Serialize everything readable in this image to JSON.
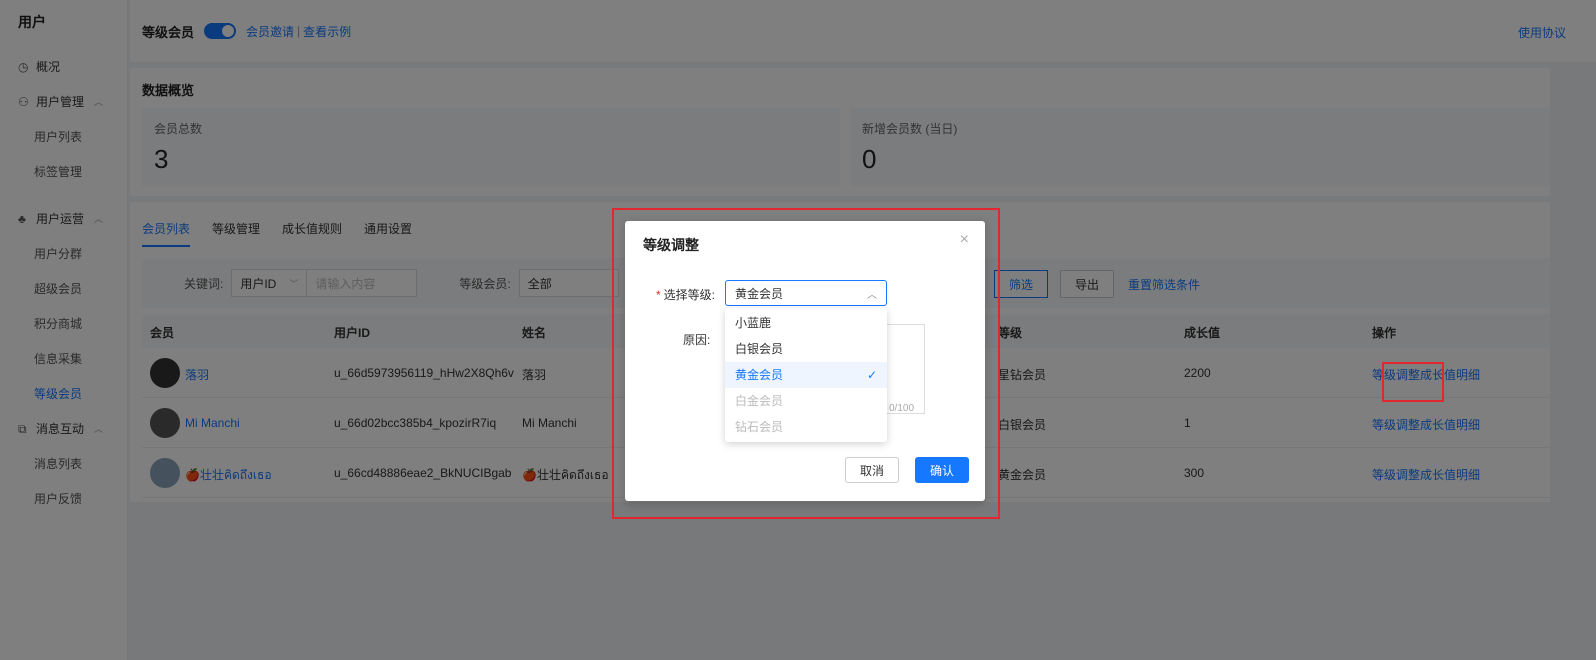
{
  "sidebar": {
    "title": "用户",
    "items": [
      {
        "icon": "clock-icon",
        "label": "概况"
      },
      {
        "icon": "users-icon",
        "label": "用户管理"
      },
      {
        "label": "用户列表"
      },
      {
        "label": "标签管理"
      },
      {
        "icon": "shop-icon",
        "label": "用户运营"
      },
      {
        "label": "用户分群"
      },
      {
        "label": "超级会员"
      },
      {
        "label": "积分商城"
      },
      {
        "label": "信息采集"
      },
      {
        "label": "等级会员"
      },
      {
        "icon": "message-icon",
        "label": "消息互动"
      },
      {
        "label": "消息列表"
      },
      {
        "label": "用户反馈"
      }
    ]
  },
  "topbar": {
    "title": "等级会员",
    "link1": "会员邀请",
    "link2": "查看示例",
    "right_link": "使用协议"
  },
  "overview": {
    "title": "数据概览",
    "total_label": "会员总数",
    "total_value": "3",
    "new_label": "新增会员数 (当日)",
    "new_value": "0"
  },
  "tabs": [
    "会员列表",
    "等级管理",
    "成长值规则",
    "通用设置"
  ],
  "filters": {
    "keyword_label": "关键词:",
    "keyword_type": "用户ID",
    "keyword_placeholder": "请输入内容",
    "level_label": "等级会员:",
    "level_value": "全部",
    "filter_btn": "筛选",
    "export_btn": "导出",
    "reset_link": "重置筛选条件"
  },
  "table": {
    "headers": [
      "会员",
      "用户ID",
      "姓名",
      "等级",
      "成长值",
      "操作"
    ],
    "rows": [
      {
        "name": "落羽",
        "user_id": "u_66d5973956119_hHw2X8Qh6v",
        "real_name": "落羽",
        "level": "星钻会员",
        "growth": "2200"
      },
      {
        "name": "Mi Manchi",
        "user_id": "u_66d02bcc385b4_kpozirR7iq",
        "real_name": "Mi Manchi",
        "level": "白银会员",
        "growth": "1"
      },
      {
        "name": "🍎壮壮คิดถึงเธอ",
        "user_id": "u_66cd48886eae2_BkNUCIBgab",
        "real_name": "🍎壮壮คิดถึงเธอ",
        "level": "黄金会员",
        "growth": "300"
      }
    ],
    "op_adjust": "等级调整",
    "op_detail": "成长值明细"
  },
  "modal": {
    "title": "等级调整",
    "close": "×",
    "level_label": "选择等级:",
    "selected": "黄金会员",
    "reason_label": "原因:",
    "count": "0/100",
    "cancel": "取消",
    "ok": "确认",
    "options": [
      {
        "label": "小蓝鹿",
        "state": "normal"
      },
      {
        "label": "白银会员",
        "state": "normal"
      },
      {
        "label": "黄金会员",
        "state": "selected"
      },
      {
        "label": "白金会员",
        "state": "disabled"
      },
      {
        "label": "钻石会员",
        "state": "disabled"
      }
    ]
  },
  "colors": {
    "accent": "#1677ff",
    "highlight": "#e0282e"
  }
}
